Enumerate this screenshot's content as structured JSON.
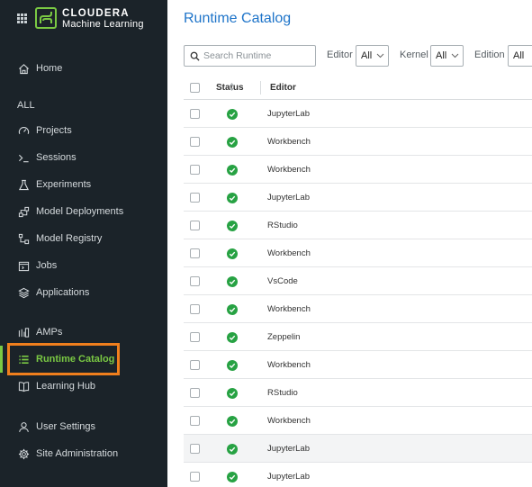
{
  "brand": {
    "line1": "CLOUDERA",
    "line2": "Machine Learning"
  },
  "sidebar": {
    "home": {
      "label": "Home",
      "icon": "home-icon"
    },
    "section_all": "ALL",
    "items": [
      {
        "label": "Projects",
        "icon": "gauge-icon"
      },
      {
        "label": "Sessions",
        "icon": "terminal-icon"
      },
      {
        "label": "Experiments",
        "icon": "flask-icon"
      },
      {
        "label": "Model Deployments",
        "icon": "deploy-icon"
      },
      {
        "label": "Model Registry",
        "icon": "registry-icon"
      },
      {
        "label": "Jobs",
        "icon": "jobs-icon"
      },
      {
        "label": "Applications",
        "icon": "layers-icon"
      }
    ],
    "amps": {
      "label": "AMPs",
      "icon": "amps-icon"
    },
    "runtime_catalog": {
      "label": "Runtime Catalog",
      "icon": "list-icon",
      "active": true
    },
    "learning_hub": {
      "label": "Learning Hub",
      "icon": "book-icon"
    },
    "user_settings": {
      "label": "User Settings",
      "icon": "user-icon"
    },
    "site_admin": {
      "label": "Site Administration",
      "icon": "gear-icon"
    }
  },
  "main": {
    "title": "Runtime Catalog",
    "search_placeholder": "Search Runtime",
    "filters": {
      "editor_label": "Editor",
      "editor_value": "All",
      "kernel_label": "Kernel",
      "kernel_value": "All",
      "edition_label": "Edition",
      "edition_value": "All"
    },
    "table": {
      "columns": [
        "Status",
        "Editor"
      ],
      "rows": [
        {
          "status": "ok",
          "editor": "JupyterLab"
        },
        {
          "status": "ok",
          "editor": "Workbench"
        },
        {
          "status": "ok",
          "editor": "Workbench"
        },
        {
          "status": "ok",
          "editor": "JupyterLab"
        },
        {
          "status": "ok",
          "editor": "RStudio"
        },
        {
          "status": "ok",
          "editor": "Workbench"
        },
        {
          "status": "ok",
          "editor": "VsCode"
        },
        {
          "status": "ok",
          "editor": "Workbench"
        },
        {
          "status": "ok",
          "editor": "Zeppelin"
        },
        {
          "status": "ok",
          "editor": "Workbench"
        },
        {
          "status": "ok",
          "editor": "RStudio"
        },
        {
          "status": "ok",
          "editor": "Workbench"
        },
        {
          "status": "ok",
          "editor": "JupyterLab"
        },
        {
          "status": "ok",
          "editor": "JupyterLab"
        }
      ]
    }
  },
  "colors": {
    "accent": "#1e74c9",
    "active": "#7ac943",
    "sidebar_bg": "#1b2329",
    "highlight": "#f07f1d",
    "ok": "#27a243"
  }
}
